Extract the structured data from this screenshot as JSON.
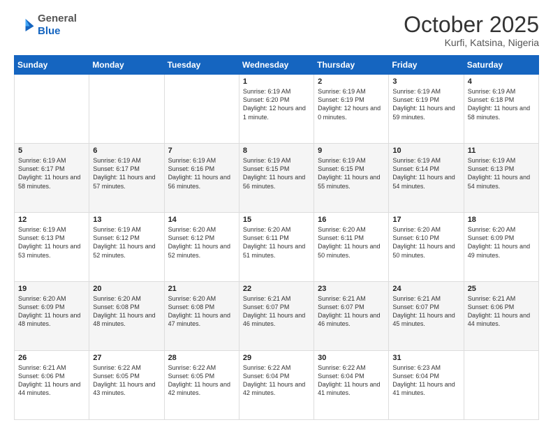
{
  "header": {
    "logo_general": "General",
    "logo_blue": "Blue",
    "title": "October 2025",
    "location": "Kurfi, Katsina, Nigeria"
  },
  "columns": [
    "Sunday",
    "Monday",
    "Tuesday",
    "Wednesday",
    "Thursday",
    "Friday",
    "Saturday"
  ],
  "rows": [
    [
      {
        "day": "",
        "info": ""
      },
      {
        "day": "",
        "info": ""
      },
      {
        "day": "",
        "info": ""
      },
      {
        "day": "1",
        "info": "Sunrise: 6:19 AM\nSunset: 6:20 PM\nDaylight: 12 hours and 1 minute."
      },
      {
        "day": "2",
        "info": "Sunrise: 6:19 AM\nSunset: 6:19 PM\nDaylight: 12 hours and 0 minutes."
      },
      {
        "day": "3",
        "info": "Sunrise: 6:19 AM\nSunset: 6:19 PM\nDaylight: 11 hours and 59 minutes."
      },
      {
        "day": "4",
        "info": "Sunrise: 6:19 AM\nSunset: 6:18 PM\nDaylight: 11 hours and 58 minutes."
      }
    ],
    [
      {
        "day": "5",
        "info": "Sunrise: 6:19 AM\nSunset: 6:17 PM\nDaylight: 11 hours and 58 minutes."
      },
      {
        "day": "6",
        "info": "Sunrise: 6:19 AM\nSunset: 6:17 PM\nDaylight: 11 hours and 57 minutes."
      },
      {
        "day": "7",
        "info": "Sunrise: 6:19 AM\nSunset: 6:16 PM\nDaylight: 11 hours and 56 minutes."
      },
      {
        "day": "8",
        "info": "Sunrise: 6:19 AM\nSunset: 6:15 PM\nDaylight: 11 hours and 56 minutes."
      },
      {
        "day": "9",
        "info": "Sunrise: 6:19 AM\nSunset: 6:15 PM\nDaylight: 11 hours and 55 minutes."
      },
      {
        "day": "10",
        "info": "Sunrise: 6:19 AM\nSunset: 6:14 PM\nDaylight: 11 hours and 54 minutes."
      },
      {
        "day": "11",
        "info": "Sunrise: 6:19 AM\nSunset: 6:13 PM\nDaylight: 11 hours and 54 minutes."
      }
    ],
    [
      {
        "day": "12",
        "info": "Sunrise: 6:19 AM\nSunset: 6:13 PM\nDaylight: 11 hours and 53 minutes."
      },
      {
        "day": "13",
        "info": "Sunrise: 6:19 AM\nSunset: 6:12 PM\nDaylight: 11 hours and 52 minutes."
      },
      {
        "day": "14",
        "info": "Sunrise: 6:20 AM\nSunset: 6:12 PM\nDaylight: 11 hours and 52 minutes."
      },
      {
        "day": "15",
        "info": "Sunrise: 6:20 AM\nSunset: 6:11 PM\nDaylight: 11 hours and 51 minutes."
      },
      {
        "day": "16",
        "info": "Sunrise: 6:20 AM\nSunset: 6:11 PM\nDaylight: 11 hours and 50 minutes."
      },
      {
        "day": "17",
        "info": "Sunrise: 6:20 AM\nSunset: 6:10 PM\nDaylight: 11 hours and 50 minutes."
      },
      {
        "day": "18",
        "info": "Sunrise: 6:20 AM\nSunset: 6:09 PM\nDaylight: 11 hours and 49 minutes."
      }
    ],
    [
      {
        "day": "19",
        "info": "Sunrise: 6:20 AM\nSunset: 6:09 PM\nDaylight: 11 hours and 48 minutes."
      },
      {
        "day": "20",
        "info": "Sunrise: 6:20 AM\nSunset: 6:08 PM\nDaylight: 11 hours and 48 minutes."
      },
      {
        "day": "21",
        "info": "Sunrise: 6:20 AM\nSunset: 6:08 PM\nDaylight: 11 hours and 47 minutes."
      },
      {
        "day": "22",
        "info": "Sunrise: 6:21 AM\nSunset: 6:07 PM\nDaylight: 11 hours and 46 minutes."
      },
      {
        "day": "23",
        "info": "Sunrise: 6:21 AM\nSunset: 6:07 PM\nDaylight: 11 hours and 46 minutes."
      },
      {
        "day": "24",
        "info": "Sunrise: 6:21 AM\nSunset: 6:07 PM\nDaylight: 11 hours and 45 minutes."
      },
      {
        "day": "25",
        "info": "Sunrise: 6:21 AM\nSunset: 6:06 PM\nDaylight: 11 hours and 44 minutes."
      }
    ],
    [
      {
        "day": "26",
        "info": "Sunrise: 6:21 AM\nSunset: 6:06 PM\nDaylight: 11 hours and 44 minutes."
      },
      {
        "day": "27",
        "info": "Sunrise: 6:22 AM\nSunset: 6:05 PM\nDaylight: 11 hours and 43 minutes."
      },
      {
        "day": "28",
        "info": "Sunrise: 6:22 AM\nSunset: 6:05 PM\nDaylight: 11 hours and 42 minutes."
      },
      {
        "day": "29",
        "info": "Sunrise: 6:22 AM\nSunset: 6:04 PM\nDaylight: 11 hours and 42 minutes."
      },
      {
        "day": "30",
        "info": "Sunrise: 6:22 AM\nSunset: 6:04 PM\nDaylight: 11 hours and 41 minutes."
      },
      {
        "day": "31",
        "info": "Sunrise: 6:23 AM\nSunset: 6:04 PM\nDaylight: 11 hours and 41 minutes."
      },
      {
        "day": "",
        "info": ""
      }
    ]
  ]
}
